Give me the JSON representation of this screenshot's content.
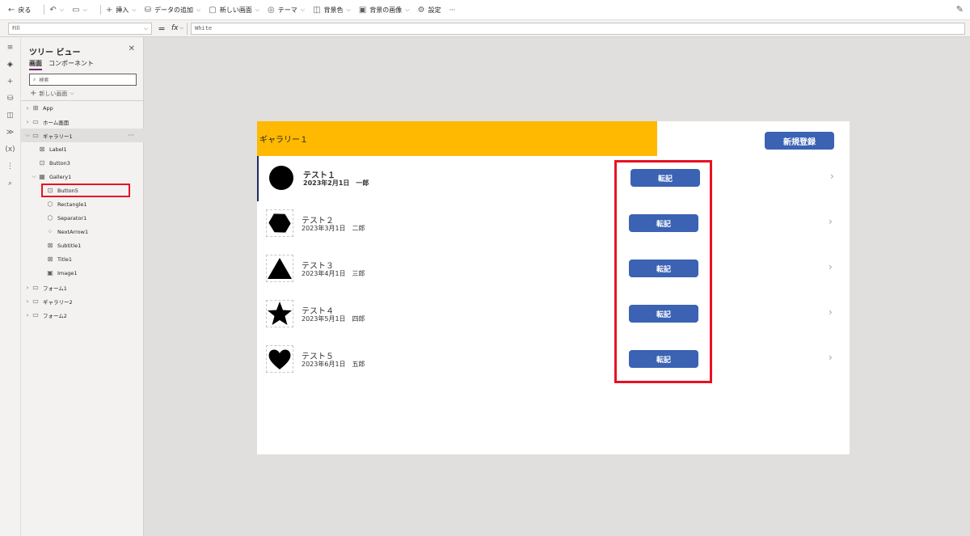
{
  "toolbar": {
    "back": "戻る",
    "insert": "挿入",
    "add_data": "データの追加",
    "new_screen": "新しい画面",
    "theme": "テーマ",
    "background_color": "背景色",
    "background_image": "背景の画像",
    "settings": "設定",
    "more": "···"
  },
  "formula": {
    "property": "Fill",
    "fx": "fx",
    "value": "White"
  },
  "tree": {
    "title": "ツリー ビュー",
    "tab_screens": "画面",
    "tab_components": "コンポーネント",
    "search_placeholder": "検索",
    "new_screen": "新しい画面",
    "nodes": [
      {
        "label": "App"
      },
      {
        "label": "ホーム画面"
      },
      {
        "label": "ギャラリー1"
      },
      {
        "label": "Label1"
      },
      {
        "label": "Button3"
      },
      {
        "label": "Gallery1"
      },
      {
        "label": "Button5"
      },
      {
        "label": "Rectangle1"
      },
      {
        "label": "Separator1"
      },
      {
        "label": "NextArrow1"
      },
      {
        "label": "Subtitle1"
      },
      {
        "label": "Title1"
      },
      {
        "label": "Image1"
      },
      {
        "label": "フォーム1"
      },
      {
        "label": "ギャラリー2"
      },
      {
        "label": "フォーム2"
      }
    ]
  },
  "canvas": {
    "header_title": "ギャラリー１",
    "new_button": "新規登録",
    "items": [
      {
        "title": "テスト１",
        "subtitle": "2023年2月1日　一郎",
        "button": "転記",
        "shape": "circle"
      },
      {
        "title": "テスト２",
        "subtitle": "2023年3月1日　二郎",
        "button": "転記",
        "shape": "hexagon"
      },
      {
        "title": "テスト３",
        "subtitle": "2023年4月1日　三郎",
        "button": "転記",
        "shape": "triangle"
      },
      {
        "title": "テスト４",
        "subtitle": "2023年5月1日　四郎",
        "button": "転記",
        "shape": "star"
      },
      {
        "title": "テスト５",
        "subtitle": "2023年6月1日　五郎",
        "button": "転記",
        "shape": "heart"
      }
    ]
  },
  "colors": {
    "header_yellow": "#ffb900",
    "button_blue": "#3b62b3",
    "highlight_red": "#e81123"
  }
}
